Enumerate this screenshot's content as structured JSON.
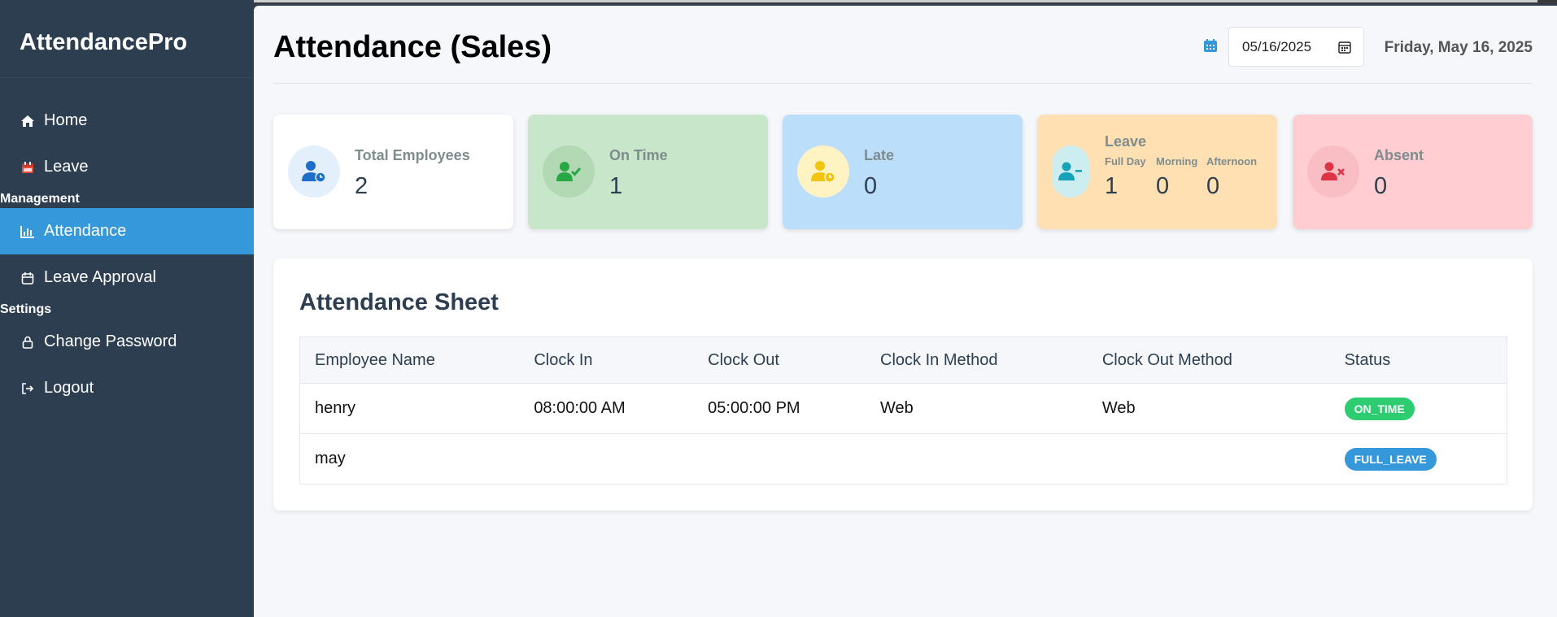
{
  "app": {
    "brand": "AttendancePro"
  },
  "sidebar": {
    "items": [
      {
        "label": "Home",
        "icon": "home-icon"
      },
      {
        "label": "Leave",
        "icon": "calendar-icon"
      }
    ],
    "management_label": "Management",
    "management_items": [
      {
        "label": "Attendance",
        "icon": "chart-icon",
        "active": true
      },
      {
        "label": "Leave Approval",
        "icon": "calendar-check-icon"
      }
    ],
    "settings_label": "Settings",
    "settings_items": [
      {
        "label": "Change Password",
        "icon": "lock-icon"
      },
      {
        "label": "Logout",
        "icon": "logout-icon"
      }
    ]
  },
  "header": {
    "title": "Attendance (Sales)",
    "date_value": "05/16/2025",
    "date_long": "Friday, May 16, 2025"
  },
  "stats": {
    "total": {
      "label": "Total Employees",
      "value": "2"
    },
    "on_time": {
      "label": "On Time",
      "value": "1"
    },
    "late": {
      "label": "Late",
      "value": "0"
    },
    "leave": {
      "label": "Leave",
      "full_day_label": "Full Day",
      "full_day_value": "1",
      "morning_label": "Morning",
      "morning_value": "0",
      "afternoon_label": "Afternoon",
      "afternoon_value": "0"
    },
    "absent": {
      "label": "Absent",
      "value": "0"
    }
  },
  "sheet": {
    "title": "Attendance Sheet",
    "columns": [
      "Employee Name",
      "Clock In",
      "Clock Out",
      "Clock In Method",
      "Clock Out Method",
      "Status"
    ],
    "rows": [
      {
        "name": "henry",
        "clock_in": "08:00:00 AM",
        "clock_out": "05:00:00 PM",
        "in_method": "Web",
        "out_method": "Web",
        "status": "ON_TIME"
      },
      {
        "name": "may",
        "clock_in": "",
        "clock_out": "",
        "in_method": "",
        "out_method": "",
        "status": "FULL_LEAVE"
      }
    ]
  },
  "colors": {
    "sidebar_bg": "#2c3e50",
    "accent": "#3498db",
    "on_time": "#2ecc71",
    "full_leave": "#3498db"
  }
}
